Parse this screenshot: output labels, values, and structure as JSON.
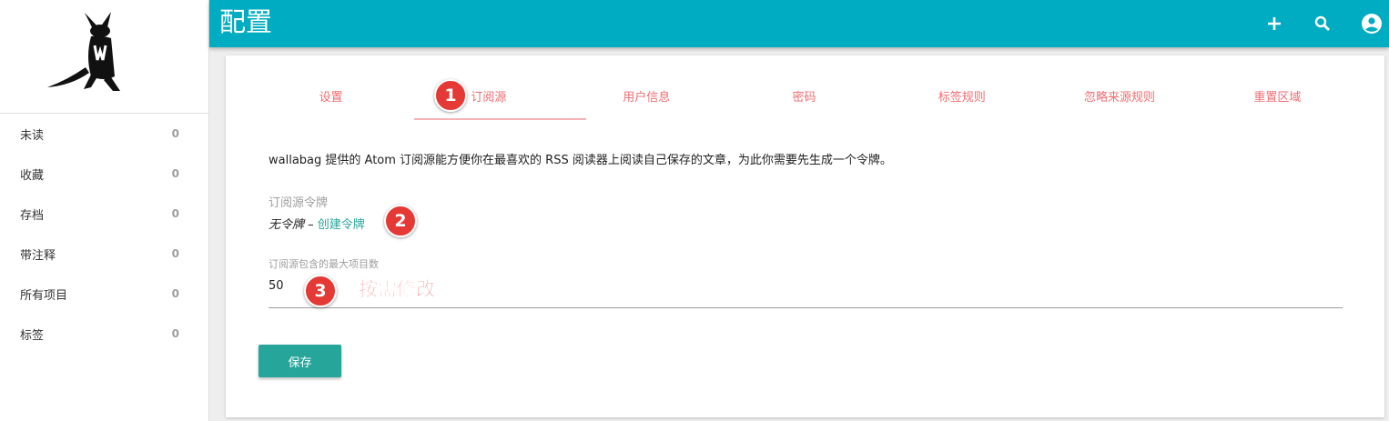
{
  "sidebar": {
    "items": [
      {
        "label": "未读",
        "count": "0"
      },
      {
        "label": "收藏",
        "count": "0"
      },
      {
        "label": "存档",
        "count": "0"
      },
      {
        "label": "带注释",
        "count": "0"
      },
      {
        "label": "所有项目",
        "count": "0"
      },
      {
        "label": "标签",
        "count": "0"
      }
    ]
  },
  "header": {
    "title": "配置",
    "icons": [
      "add-icon",
      "search-icon",
      "account-icon"
    ],
    "color": "#00acc1"
  },
  "tabs": [
    "设置",
    "订阅源",
    "用户信息",
    "密码",
    "标签规则",
    "忽略来源规则",
    "重置区域"
  ],
  "active_tab": "订阅源",
  "feed": {
    "description": "wallabag 提供的 Atom 订阅源能方便你在最喜欢的 RSS 阅读器上阅读自己保存的文章，为此你需要先生成一个令牌。",
    "token_label": "订阅源令牌",
    "no_token": "无令牌",
    "separator": " – ",
    "create_token": "创建令牌",
    "max_items_label": "订阅源包含的最大项目数",
    "max_items_value": "50",
    "save_label": "保存"
  },
  "annotations": {
    "markers": [
      "1",
      "2",
      "3"
    ],
    "note": "按需修改",
    "color": "#e53935"
  },
  "colors": {
    "accent": "#26a69a",
    "tab_text": "#ee6e73"
  }
}
